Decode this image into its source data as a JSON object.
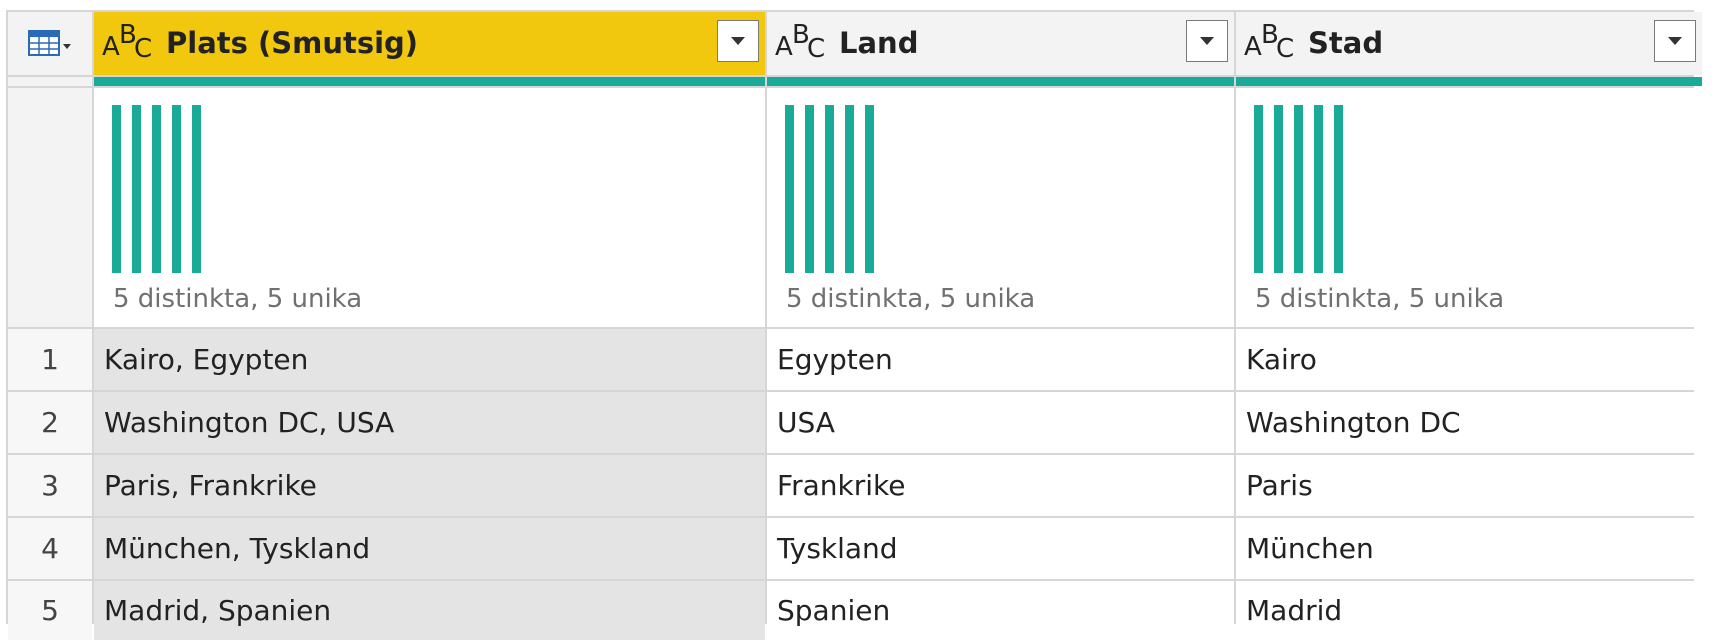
{
  "table": {
    "type_icon_label": {
      "a": "A",
      "b": "B",
      "c": "C"
    },
    "columns": [
      {
        "title": "Plats (Smutsig)",
        "selected": true,
        "stats": "5 distinkta, 5 unika",
        "bars": 5
      },
      {
        "title": "Land",
        "selected": false,
        "stats": "5 distinkta, 5 unika",
        "bars": 5
      },
      {
        "title": "Stad",
        "selected": false,
        "stats": "5 distinkta, 5 unika",
        "bars": 5
      }
    ],
    "rows": [
      {
        "num": "1",
        "cells": [
          "Kairo, Egypten",
          "Egypten",
          "Kairo"
        ]
      },
      {
        "num": "2",
        "cells": [
          "Washington DC, USA",
          "USA",
          "Washington DC"
        ]
      },
      {
        "num": "3",
        "cells": [
          "Paris, Frankrike",
          "Frankrike",
          "Paris"
        ]
      },
      {
        "num": "4",
        "cells": [
          "München, Tyskland",
          "Tyskland",
          "München"
        ]
      },
      {
        "num": "5",
        "cells": [
          "Madrid, Spanien",
          "Spanien",
          "Madrid"
        ]
      }
    ]
  },
  "colors": {
    "selected_header": "#f2c80f",
    "quality_bar": "#1aaa98",
    "distribution_bar": "#1aaa98",
    "selected_column_bg": "#e4e4e4"
  },
  "icons": {
    "corner": "table-menu-icon",
    "type": "text-type-abc-icon",
    "dropdown": "chevron-down-icon"
  }
}
